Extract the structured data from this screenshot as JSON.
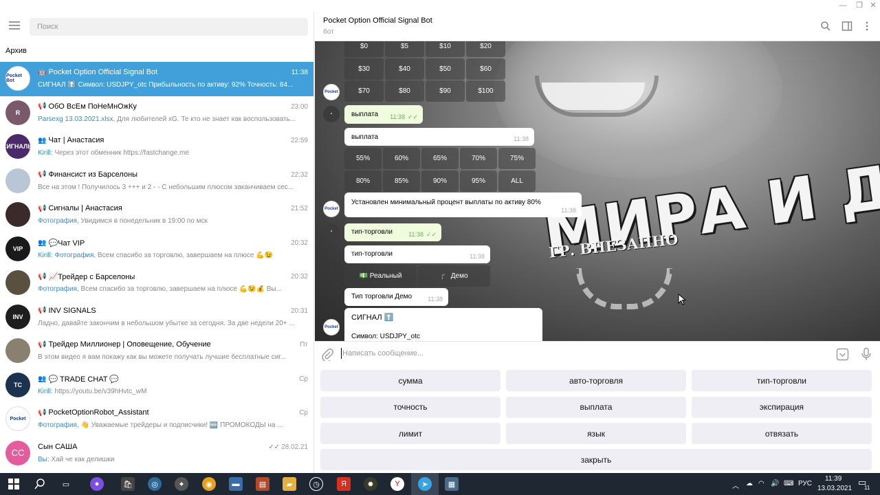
{
  "left_panel": {
    "search_placeholder": "Поиск",
    "archive_label": "Архив",
    "chats": [
      {
        "title": "Pocket Option Official Signal Bot",
        "time": "11:38",
        "sender": "",
        "preview": "СИГНАЛ ⬆️  Символ: USDJPY_otc Прибыльность по активу: 92% Точность: 84...",
        "type_icon": "bot-icon",
        "avatar_text": "Pocket Bot",
        "avatar_color": "#ffffff",
        "active": true
      },
      {
        "title": "ОбО ВсЕм ПоНеМнОжКу",
        "time": "23:00",
        "sender": "Parsexg 13.03.2021.xlsx,",
        "preview": " Для любителей xG. Те кто не знает как воспользовать...",
        "type_icon": "channel-icon",
        "avatar_text": "R",
        "avatar_color": "#7a5a6a"
      },
      {
        "title": "Чат | Анастасия",
        "time": "22:59",
        "sender": "Kirill:",
        "preview": " Через этот обменник https://fastchange.me",
        "type_icon": "group-icon",
        "avatar_text": "СИГНАЛЫ",
        "avatar_color": "#4a2a6a"
      },
      {
        "title": "Финансист из Барселоны",
        "time": "22:32",
        "sender": "",
        "preview": "Все на этом !  Получилось 3 +++ и 2 - - С небольшим плюсом заканчиваем сес...",
        "type_icon": "channel-icon",
        "avatar_text": "",
        "avatar_color": "#b8c6d6"
      },
      {
        "title": "Сигналы | Анастасия",
        "time": "21:52",
        "sender": "Фотография,",
        "preview": " Увидимся в понедельник в 19:00 по мск",
        "type_icon": "channel-icon",
        "avatar_text": "",
        "avatar_color": "#3a2a2a"
      },
      {
        "title": "💬Чат VIP",
        "time": "20:32",
        "sender": "Kirill: Фотография,",
        "preview": " Всем спасибо за торговлю, завершаем на плюсе 💪😉",
        "type_icon": "group-icon",
        "avatar_text": "VIP",
        "avatar_color": "#1a1a1a"
      },
      {
        "title": "📈Трейдер с Барселоны",
        "time": "20:32",
        "sender": "Фотография,",
        "preview": " Всем спасибо за торговлю, завершаем на плюсе 💪😉💰 Вы...",
        "type_icon": "channel-icon",
        "avatar_text": "",
        "avatar_color": "#5a5040"
      },
      {
        "title": "INV SIGNALS",
        "time": "20:31",
        "sender": "",
        "preview": "Ладно, давайте закончим в небольшом убытке за сегодня. За две недели 20+ ...",
        "type_icon": "channel-icon",
        "avatar_text": "INV",
        "avatar_color": "#1e1e1e"
      },
      {
        "title": "Трейдер Миллионер | Оповещение, Обучение",
        "time": "Пт",
        "sender": "",
        "preview": "В этом видео я вам покажу как вы можете получать лучшие бесплатные сиг...",
        "type_icon": "channel-icon",
        "avatar_text": "",
        "avatar_color": "#8a8070"
      },
      {
        "title": "💬 TRADE CHAT 💬",
        "time": "Ср",
        "sender": "Kirill:",
        "preview": " https://youtu.be/v39hHvtc_wM",
        "type_icon": "group-icon",
        "avatar_text": "TC",
        "avatar_color": "#1b3350"
      },
      {
        "title": "PocketOptionRobot_Assistant",
        "time": "Ср",
        "sender": "Фотография,",
        "preview": " 👋 Уважаемые трейдеры и подписчики! 🆕 ПРОМОКОДЫ на ...",
        "type_icon": "channel-icon",
        "avatar_text": "Pocket",
        "avatar_color": "#ffffff"
      },
      {
        "title": "Сын САША",
        "time": "28.02.21",
        "sender": "Вы:",
        "preview": " Хай че как делишки",
        "type_icon": "",
        "avatar_text": "СС",
        "avatar_color": "#e45c9c",
        "read_check": true
      }
    ]
  },
  "header": {
    "title": "Pocket Option Official Signal Bot",
    "subtitle": "бот"
  },
  "messages": {
    "amount_rows": [
      [
        "$0",
        "$5",
        "$10",
        "$20"
      ],
      [
        "$30",
        "$40",
        "$50",
        "$60"
      ],
      [
        "$70",
        "$80",
        "$90",
        "$100"
      ]
    ],
    "out_payout": {
      "text": "выплата",
      "time": "11:38"
    },
    "in_payout": {
      "text": "выплата",
      "time": "11:38"
    },
    "percent_rows": [
      [
        "55%",
        "60%",
        "65%",
        "70%",
        "75%"
      ],
      [
        "80%",
        "85%",
        "90%",
        "95%",
        "ALL"
      ]
    ],
    "min_payout_msg": {
      "text": "Установлен минимальный процент выплаты по активу 80%",
      "time": "11:38"
    },
    "out_trade_type": {
      "text": "тип-торговли",
      "time": "11:38"
    },
    "in_trade_type": {
      "text": "тип-торговли",
      "time": "11:38"
    },
    "trade_type_buttons": [
      "💵 Реальный",
      "🎓 Демо"
    ],
    "demo_msg": {
      "text": "Тип торговли Демо",
      "time": "11:38"
    },
    "signal": {
      "title": "СИГНАЛ ⬆️",
      "symbol": "Символ: USDJPY_otc"
    },
    "wallpaper": {
      "big_text": "МИРА И ДОБРА!",
      "small_text": "ГР. ВНЕЗАПНО"
    }
  },
  "composer": {
    "placeholder": "Написать сообщение..."
  },
  "reply_keyboard": {
    "row1": [
      "сумма",
      "авто-торговля",
      "тип-торговли"
    ],
    "row2": [
      "точность",
      "выплата",
      "экспирация"
    ],
    "row3": [
      "лимит",
      "язык",
      "отвязать"
    ],
    "row4": [
      "закрыть"
    ]
  },
  "taskbar": {
    "lang": "РУС",
    "time": "11:39",
    "date": "13.03.2021",
    "notif_count": "11"
  },
  "colors": {
    "accent": "#419fd9",
    "taskbar": "#1f2733",
    "reply_button": "#f0eef5"
  }
}
